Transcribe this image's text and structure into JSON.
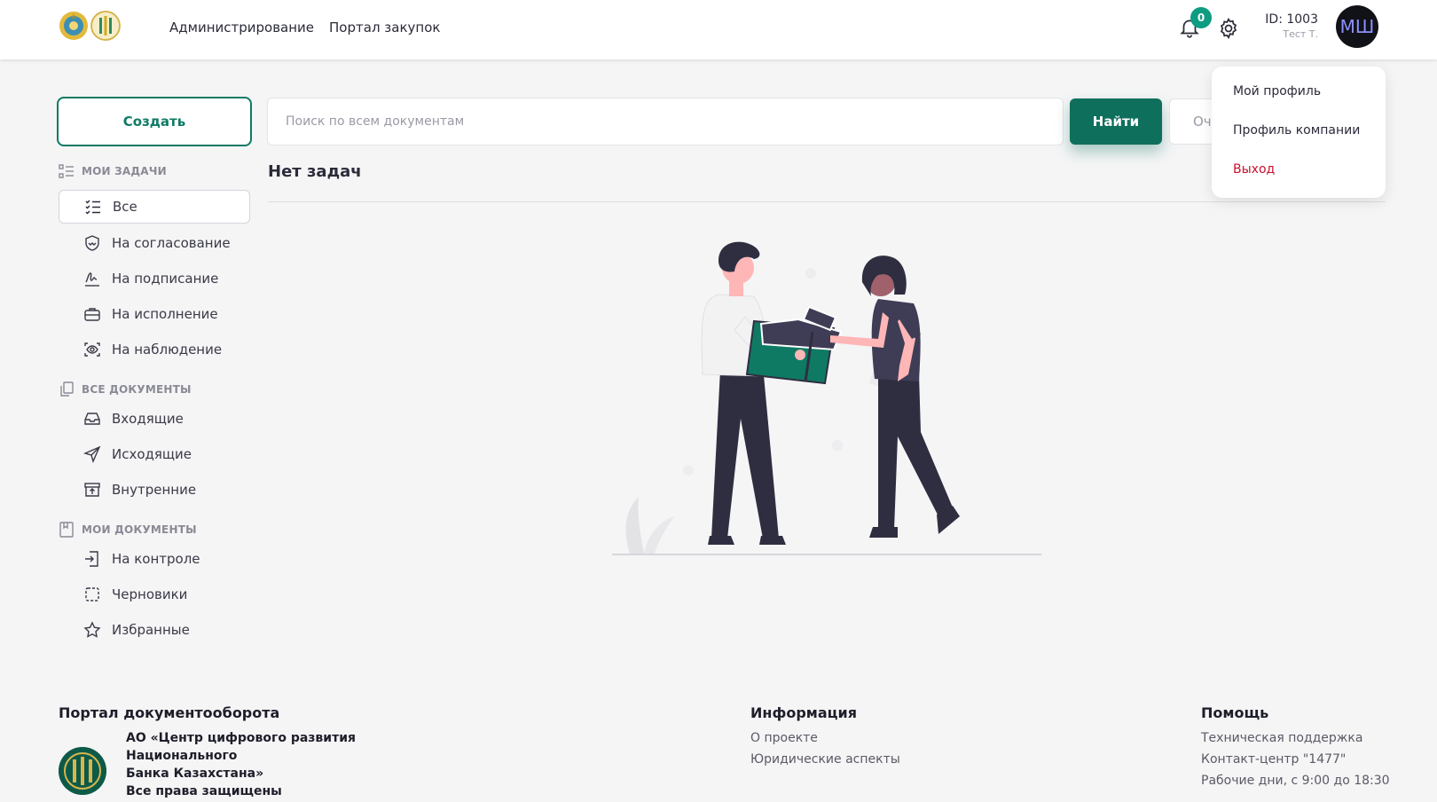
{
  "header": {
    "nav": [
      "Администрирование",
      "Портал закупок"
    ],
    "notifications_count": "0",
    "user_id": "ID: 1003",
    "user_name": "Тест Т.",
    "avatar_initials": "МШ"
  },
  "dropdown": {
    "items": [
      "Мой профиль",
      "Профиль компании",
      "Выход"
    ]
  },
  "toolbar": {
    "create_label": "Создать",
    "search_placeholder": "Поиск по всем документам",
    "find_label": "Найти",
    "clear_label": "Оч"
  },
  "sidebar": {
    "sections": [
      {
        "title": "МОИ ЗАДАЧИ",
        "items": [
          "Все",
          "На согласование",
          "На подписание",
          "На исполнение",
          "На наблюдение"
        ]
      },
      {
        "title": "ВСЕ ДОКУМЕНТЫ",
        "items": [
          "Входящие",
          "Исходящие",
          "Внутренние"
        ]
      },
      {
        "title": "МОИ ДОКУМЕНТЫ",
        "items": [
          "На контроле",
          "Черновики",
          "Избранные"
        ]
      }
    ]
  },
  "main": {
    "heading": "Нет задач"
  },
  "footer": {
    "portal_title": "Портал документооборота",
    "org_line1": "АО «Центр цифрового развития Национального",
    "org_line2": "Банка Казахстана»",
    "org_line3": "Все права защищены",
    "info_title": "Информация",
    "info_links": [
      "О проекте",
      "Юридические аспекты"
    ],
    "help_title": "Помощь",
    "help_links": [
      "Техническая поддержка",
      "Контакт-центр \"1477\"",
      "Рабочие дни, с 9:00 до 18:30"
    ]
  },
  "colors": {
    "accent": "#0e6f5c",
    "badge": "#0e9c82",
    "logout": "#c8102e"
  }
}
